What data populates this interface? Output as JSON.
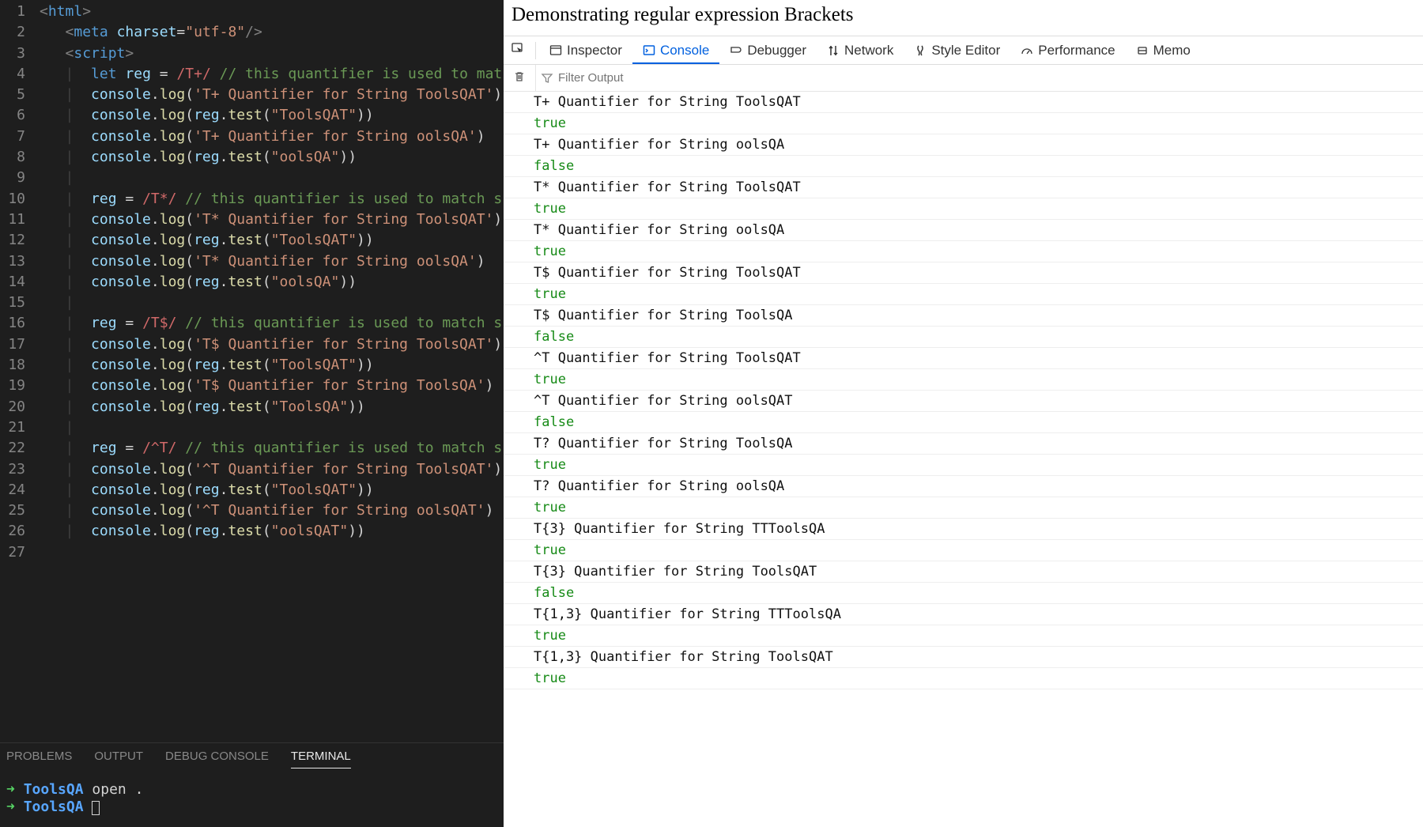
{
  "editor": {
    "lines": [
      {
        "n": 1,
        "segs": [
          [
            "",
            ""
          ],
          [
            "tok-tag",
            "<"
          ],
          [
            "tok-el",
            "html"
          ],
          [
            "tok-tag",
            ">"
          ]
        ]
      },
      {
        "n": 2,
        "segs": [
          [
            "",
            "   "
          ],
          [
            "tok-tag",
            "<"
          ],
          [
            "tok-el",
            "meta"
          ],
          [
            "",
            " "
          ],
          [
            "tok-attr",
            "charset"
          ],
          [
            "tok-op",
            "="
          ],
          [
            "tok-str",
            "\"utf-8\""
          ],
          [
            "tok-tag",
            "/>"
          ]
        ]
      },
      {
        "n": 3,
        "segs": [
          [
            "",
            "   "
          ],
          [
            "tok-tag",
            "<"
          ],
          [
            "tok-el",
            "script"
          ],
          [
            "tok-tag",
            ">"
          ]
        ]
      },
      {
        "n": 4,
        "segs": [
          [
            "",
            "   "
          ],
          [
            "guide",
            "|  "
          ],
          [
            "tok-kw",
            "let"
          ],
          [
            "",
            " "
          ],
          [
            "tok-var",
            "reg"
          ],
          [
            "",
            " "
          ],
          [
            "tok-op",
            "="
          ],
          [
            "",
            " "
          ],
          [
            "tok-re",
            "/T+/"
          ],
          [
            "",
            " "
          ],
          [
            "tok-cm",
            "// this quantifier is used to mat"
          ]
        ]
      },
      {
        "n": 5,
        "segs": [
          [
            "",
            "   "
          ],
          [
            "guide",
            "|  "
          ],
          [
            "tok-obj",
            "console"
          ],
          [
            "tok-op",
            "."
          ],
          [
            "tok-fn",
            "log"
          ],
          [
            "tok-op",
            "("
          ],
          [
            "tok-str",
            "'T+ Quantifier for String ToolsQAT'"
          ],
          [
            "tok-op",
            ")"
          ]
        ]
      },
      {
        "n": 6,
        "segs": [
          [
            "",
            "   "
          ],
          [
            "guide",
            "|  "
          ],
          [
            "tok-obj",
            "console"
          ],
          [
            "tok-op",
            "."
          ],
          [
            "tok-fn",
            "log"
          ],
          [
            "tok-op",
            "("
          ],
          [
            "tok-var",
            "reg"
          ],
          [
            "tok-op",
            "."
          ],
          [
            "tok-fn",
            "test"
          ],
          [
            "tok-op",
            "("
          ],
          [
            "tok-str",
            "\"ToolsQAT\""
          ],
          [
            "tok-op",
            "))"
          ]
        ]
      },
      {
        "n": 7,
        "segs": [
          [
            "",
            "   "
          ],
          [
            "guide",
            "|  "
          ],
          [
            "tok-obj",
            "console"
          ],
          [
            "tok-op",
            "."
          ],
          [
            "tok-fn",
            "log"
          ],
          [
            "tok-op",
            "("
          ],
          [
            "tok-str",
            "'T+ Quantifier for String oolsQA'"
          ],
          [
            "tok-op",
            ")"
          ]
        ]
      },
      {
        "n": 8,
        "segs": [
          [
            "",
            "   "
          ],
          [
            "guide",
            "|  "
          ],
          [
            "tok-obj",
            "console"
          ],
          [
            "tok-op",
            "."
          ],
          [
            "tok-fn",
            "log"
          ],
          [
            "tok-op",
            "("
          ],
          [
            "tok-var",
            "reg"
          ],
          [
            "tok-op",
            "."
          ],
          [
            "tok-fn",
            "test"
          ],
          [
            "tok-op",
            "("
          ],
          [
            "tok-str",
            "\"oolsQA\""
          ],
          [
            "tok-op",
            "))"
          ]
        ]
      },
      {
        "n": 9,
        "segs": [
          [
            "",
            "   "
          ],
          [
            "guide",
            "|"
          ]
        ]
      },
      {
        "n": 10,
        "segs": [
          [
            "",
            "   "
          ],
          [
            "guide",
            "|  "
          ],
          [
            "tok-var",
            "reg"
          ],
          [
            "",
            " "
          ],
          [
            "tok-op",
            "="
          ],
          [
            "",
            " "
          ],
          [
            "tok-re",
            "/T*/"
          ],
          [
            "",
            " "
          ],
          [
            "tok-cm",
            "// this quantifier is used to match s"
          ]
        ]
      },
      {
        "n": 11,
        "segs": [
          [
            "",
            "   "
          ],
          [
            "guide",
            "|  "
          ],
          [
            "tok-obj",
            "console"
          ],
          [
            "tok-op",
            "."
          ],
          [
            "tok-fn",
            "log"
          ],
          [
            "tok-op",
            "("
          ],
          [
            "tok-str",
            "'T* Quantifier for String ToolsQAT'"
          ],
          [
            "tok-op",
            ")"
          ]
        ]
      },
      {
        "n": 12,
        "segs": [
          [
            "",
            "   "
          ],
          [
            "guide",
            "|  "
          ],
          [
            "tok-obj",
            "console"
          ],
          [
            "tok-op",
            "."
          ],
          [
            "tok-fn",
            "log"
          ],
          [
            "tok-op",
            "("
          ],
          [
            "tok-var",
            "reg"
          ],
          [
            "tok-op",
            "."
          ],
          [
            "tok-fn",
            "test"
          ],
          [
            "tok-op",
            "("
          ],
          [
            "tok-str",
            "\"ToolsQAT\""
          ],
          [
            "tok-op",
            "))"
          ]
        ]
      },
      {
        "n": 13,
        "segs": [
          [
            "",
            "   "
          ],
          [
            "guide",
            "|  "
          ],
          [
            "tok-obj",
            "console"
          ],
          [
            "tok-op",
            "."
          ],
          [
            "tok-fn",
            "log"
          ],
          [
            "tok-op",
            "("
          ],
          [
            "tok-str",
            "'T* Quantifier for String oolsQA'"
          ],
          [
            "tok-op",
            ")"
          ]
        ]
      },
      {
        "n": 14,
        "segs": [
          [
            "",
            "   "
          ],
          [
            "guide",
            "|  "
          ],
          [
            "tok-obj",
            "console"
          ],
          [
            "tok-op",
            "."
          ],
          [
            "tok-fn",
            "log"
          ],
          [
            "tok-op",
            "("
          ],
          [
            "tok-var",
            "reg"
          ],
          [
            "tok-op",
            "."
          ],
          [
            "tok-fn",
            "test"
          ],
          [
            "tok-op",
            "("
          ],
          [
            "tok-str",
            "\"oolsQA\""
          ],
          [
            "tok-op",
            "))"
          ]
        ]
      },
      {
        "n": 15,
        "segs": [
          [
            "",
            "   "
          ],
          [
            "guide",
            "|"
          ]
        ]
      },
      {
        "n": 16,
        "segs": [
          [
            "",
            "   "
          ],
          [
            "guide",
            "|  "
          ],
          [
            "tok-var",
            "reg"
          ],
          [
            "",
            " "
          ],
          [
            "tok-op",
            "="
          ],
          [
            "",
            " "
          ],
          [
            "tok-re",
            "/T$/"
          ],
          [
            "",
            " "
          ],
          [
            "tok-cm",
            "// this quantifier is used to match s"
          ]
        ]
      },
      {
        "n": 17,
        "segs": [
          [
            "",
            "   "
          ],
          [
            "guide",
            "|  "
          ],
          [
            "tok-obj",
            "console"
          ],
          [
            "tok-op",
            "."
          ],
          [
            "tok-fn",
            "log"
          ],
          [
            "tok-op",
            "("
          ],
          [
            "tok-str",
            "'T$ Quantifier for String ToolsQAT'"
          ],
          [
            "tok-op",
            ")"
          ]
        ]
      },
      {
        "n": 18,
        "segs": [
          [
            "",
            "   "
          ],
          [
            "guide",
            "|  "
          ],
          [
            "tok-obj",
            "console"
          ],
          [
            "tok-op",
            "."
          ],
          [
            "tok-fn",
            "log"
          ],
          [
            "tok-op",
            "("
          ],
          [
            "tok-var",
            "reg"
          ],
          [
            "tok-op",
            "."
          ],
          [
            "tok-fn",
            "test"
          ],
          [
            "tok-op",
            "("
          ],
          [
            "tok-str",
            "\"ToolsQAT\""
          ],
          [
            "tok-op",
            "))"
          ]
        ]
      },
      {
        "n": 19,
        "segs": [
          [
            "",
            "   "
          ],
          [
            "guide",
            "|  "
          ],
          [
            "tok-obj",
            "console"
          ],
          [
            "tok-op",
            "."
          ],
          [
            "tok-fn",
            "log"
          ],
          [
            "tok-op",
            "("
          ],
          [
            "tok-str",
            "'T$ Quantifier for String ToolsQA'"
          ],
          [
            "tok-op",
            ")"
          ]
        ]
      },
      {
        "n": 20,
        "segs": [
          [
            "",
            "   "
          ],
          [
            "guide",
            "|  "
          ],
          [
            "tok-obj",
            "console"
          ],
          [
            "tok-op",
            "."
          ],
          [
            "tok-fn",
            "log"
          ],
          [
            "tok-op",
            "("
          ],
          [
            "tok-var",
            "reg"
          ],
          [
            "tok-op",
            "."
          ],
          [
            "tok-fn",
            "test"
          ],
          [
            "tok-op",
            "("
          ],
          [
            "tok-str",
            "\"ToolsQA\""
          ],
          [
            "tok-op",
            "))"
          ]
        ]
      },
      {
        "n": 21,
        "segs": [
          [
            "",
            "   "
          ],
          [
            "guide",
            "|"
          ]
        ]
      },
      {
        "n": 22,
        "segs": [
          [
            "",
            "   "
          ],
          [
            "guide",
            "|  "
          ],
          [
            "tok-var",
            "reg"
          ],
          [
            "",
            " "
          ],
          [
            "tok-op",
            "="
          ],
          [
            "",
            " "
          ],
          [
            "tok-re",
            "/^T/"
          ],
          [
            "",
            " "
          ],
          [
            "tok-cm",
            "// this quantifier is used to match s"
          ]
        ]
      },
      {
        "n": 23,
        "segs": [
          [
            "",
            "   "
          ],
          [
            "guide",
            "|  "
          ],
          [
            "tok-obj",
            "console"
          ],
          [
            "tok-op",
            "."
          ],
          [
            "tok-fn",
            "log"
          ],
          [
            "tok-op",
            "("
          ],
          [
            "tok-str",
            "'^T Quantifier for String ToolsQAT'"
          ],
          [
            "tok-op",
            ")"
          ]
        ]
      },
      {
        "n": 24,
        "segs": [
          [
            "",
            "   "
          ],
          [
            "guide",
            "|  "
          ],
          [
            "tok-obj",
            "console"
          ],
          [
            "tok-op",
            "."
          ],
          [
            "tok-fn",
            "log"
          ],
          [
            "tok-op",
            "("
          ],
          [
            "tok-var",
            "reg"
          ],
          [
            "tok-op",
            "."
          ],
          [
            "tok-fn",
            "test"
          ],
          [
            "tok-op",
            "("
          ],
          [
            "tok-str",
            "\"ToolsQAT\""
          ],
          [
            "tok-op",
            "))"
          ]
        ]
      },
      {
        "n": 25,
        "segs": [
          [
            "",
            "   "
          ],
          [
            "guide",
            "|  "
          ],
          [
            "tok-obj",
            "console"
          ],
          [
            "tok-op",
            "."
          ],
          [
            "tok-fn",
            "log"
          ],
          [
            "tok-op",
            "("
          ],
          [
            "tok-str",
            "'^T Quantifier for String oolsQAT'"
          ],
          [
            "tok-op",
            ")"
          ]
        ]
      },
      {
        "n": 26,
        "segs": [
          [
            "",
            "   "
          ],
          [
            "guide",
            "|  "
          ],
          [
            "tok-obj",
            "console"
          ],
          [
            "tok-op",
            "."
          ],
          [
            "tok-fn",
            "log"
          ],
          [
            "tok-op",
            "("
          ],
          [
            "tok-var",
            "reg"
          ],
          [
            "tok-op",
            "."
          ],
          [
            "tok-fn",
            "test"
          ],
          [
            "tok-op",
            "("
          ],
          [
            "tok-str",
            "\"oolsQAT\""
          ],
          [
            "tok-op",
            "))"
          ]
        ]
      },
      {
        "n": 27,
        "segs": [
          [
            "",
            ""
          ]
        ]
      }
    ],
    "panel_tabs": {
      "problems": "PROBLEMS",
      "output": "OUTPUT",
      "debug": "DEBUG CONSOLE",
      "terminal": "TERMINAL"
    },
    "terminal": [
      {
        "prompt": "ToolsQA",
        "cmd": "open ."
      },
      {
        "prompt": "ToolsQA",
        "cmd": ""
      }
    ]
  },
  "browser": {
    "page_title": "Demonstrating regular expression Brackets",
    "devtools_tabs": {
      "inspector": "Inspector",
      "console": "Console",
      "debugger": "Debugger",
      "network": "Network",
      "style_editor": "Style Editor",
      "performance": "Performance",
      "memory": "Memo"
    },
    "filter_placeholder": "Filter Output",
    "console": [
      {
        "text": "T+ Quantifier for String ToolsQAT",
        "type": "msg"
      },
      {
        "text": "true",
        "type": "bool"
      },
      {
        "text": "T+ Quantifier for String oolsQA",
        "type": "msg"
      },
      {
        "text": "false",
        "type": "bool"
      },
      {
        "text": "T* Quantifier for String ToolsQAT",
        "type": "msg"
      },
      {
        "text": "true",
        "type": "bool"
      },
      {
        "text": "T* Quantifier for String oolsQA",
        "type": "msg"
      },
      {
        "text": "true",
        "type": "bool"
      },
      {
        "text": "T$ Quantifier for String ToolsQAT",
        "type": "msg"
      },
      {
        "text": "true",
        "type": "bool"
      },
      {
        "text": "T$ Quantifier for String ToolsQA",
        "type": "msg"
      },
      {
        "text": "false",
        "type": "bool"
      },
      {
        "text": "^T Quantifier for String ToolsQAT",
        "type": "msg"
      },
      {
        "text": "true",
        "type": "bool"
      },
      {
        "text": "^T Quantifier for String oolsQAT",
        "type": "msg"
      },
      {
        "text": "false",
        "type": "bool"
      },
      {
        "text": "T? Quantifier for String ToolsQA",
        "type": "msg"
      },
      {
        "text": "true",
        "type": "bool"
      },
      {
        "text": "T? Quantifier for String oolsQA",
        "type": "msg"
      },
      {
        "text": "true",
        "type": "bool"
      },
      {
        "text": "T{3} Quantifier for String TTToolsQA",
        "type": "msg"
      },
      {
        "text": "true",
        "type": "bool"
      },
      {
        "text": "T{3} Quantifier for String ToolsQAT",
        "type": "msg"
      },
      {
        "text": "false",
        "type": "bool"
      },
      {
        "text": "T{1,3} Quantifier for String TTToolsQA",
        "type": "msg"
      },
      {
        "text": "true",
        "type": "bool"
      },
      {
        "text": "T{1,3} Quantifier for String ToolsQAT",
        "type": "msg"
      },
      {
        "text": "true",
        "type": "bool"
      }
    ]
  }
}
